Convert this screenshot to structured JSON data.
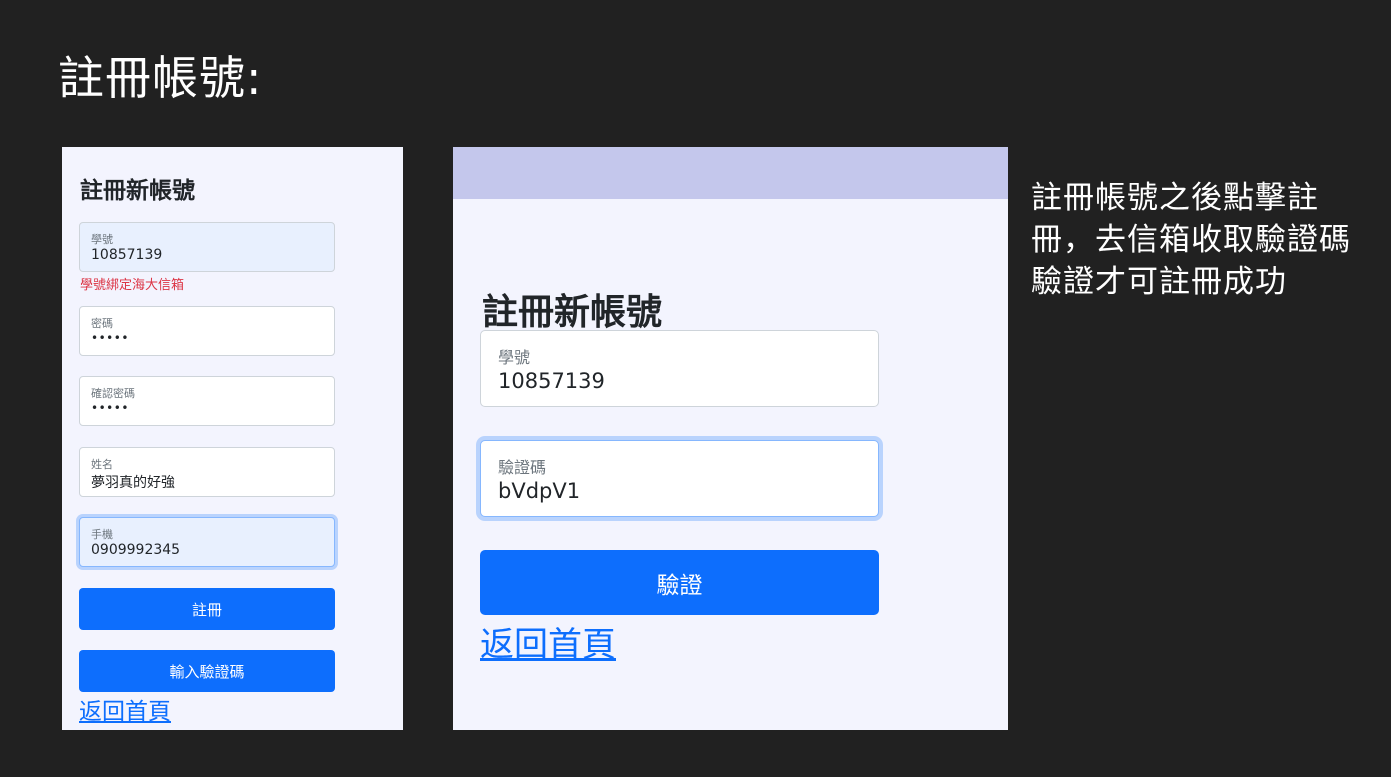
{
  "slide": {
    "title": "註冊帳號:",
    "note": "註冊帳號之後點擊註冊，去信箱收取驗證碼驗證才可註冊成功"
  },
  "panel1": {
    "title": "註冊新帳號",
    "student_id": {
      "label": "學號",
      "value": "10857139"
    },
    "hint": "學號綁定海大信箱",
    "password": {
      "label": "密碼",
      "value": "•••••"
    },
    "confirm_password": {
      "label": "確認密碼",
      "value": "•••••"
    },
    "name": {
      "label": "姓名",
      "value": "夢羽真的好強"
    },
    "phone": {
      "label": "手機",
      "value": "0909992345"
    },
    "register_button": "註冊",
    "enter_code_button": "輸入驗證碼",
    "back_home_link": "返回首頁"
  },
  "panel2": {
    "title": "註冊新帳號",
    "student_id": {
      "label": "學號",
      "value": "10857139"
    },
    "verification_code": {
      "label": "驗證碼",
      "value": "bVdpV1"
    },
    "verify_button": "驗證",
    "back_home_link": "返回首頁"
  },
  "colors": {
    "background": "#212121",
    "panel_bg": "#f3f4fe",
    "header_bar": "#c4c7ec",
    "primary": "#0d6efd",
    "error": "#dc3545"
  }
}
